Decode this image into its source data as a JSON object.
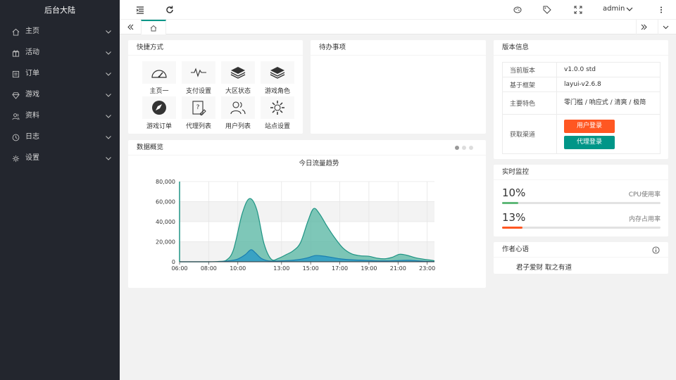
{
  "app": {
    "title": "后台大陆"
  },
  "sidebar": {
    "items": [
      {
        "label": "主页",
        "icon": "home-icon"
      },
      {
        "label": "活动",
        "icon": "gift-icon"
      },
      {
        "label": "订单",
        "icon": "order-icon"
      },
      {
        "label": "游戏",
        "icon": "diamond-icon"
      },
      {
        "label": "资料",
        "icon": "users-icon"
      },
      {
        "label": "日志",
        "icon": "clock-icon"
      },
      {
        "label": "设置",
        "icon": "gear-icon"
      }
    ]
  },
  "header": {
    "user": "admin",
    "icons": [
      "menu-fold-icon",
      "refresh-icon",
      "theme-icon",
      "tag-icon",
      "fullscreen-icon",
      "more-icon"
    ]
  },
  "tabs": {
    "home_icon": "home-icon"
  },
  "shortcuts": {
    "title": "快捷方式",
    "items": [
      {
        "label": "主页一",
        "icon": "dashboard-icon"
      },
      {
        "label": "支付设置",
        "icon": "pulse-icon"
      },
      {
        "label": "大区状态",
        "icon": "layers-icon"
      },
      {
        "label": "游戏角色",
        "icon": "layers-icon"
      },
      {
        "label": "游戏订单",
        "icon": "compass-icon"
      },
      {
        "label": "代理列表",
        "icon": "help-doc-icon"
      },
      {
        "label": "用户列表",
        "icon": "users-icon"
      },
      {
        "label": "站点设置",
        "icon": "gear-icon"
      }
    ]
  },
  "todo": {
    "title": "待办事项"
  },
  "version": {
    "title": "版本信息",
    "rows": [
      {
        "key": "当前版本",
        "value": "v1.0.0 std"
      },
      {
        "key": "基于框架",
        "value": "layui-v2.6.8"
      },
      {
        "key": "主要特色",
        "value": "零门槛 / 响应式 / 清爽 / 极简"
      },
      {
        "key": "获取渠道"
      }
    ],
    "buttons": [
      {
        "label": "用户登录",
        "color": "#ff5722"
      },
      {
        "label": "代理登录",
        "color": "#009688"
      }
    ]
  },
  "monitor": {
    "title": "实时监控",
    "items": [
      {
        "value": "10%",
        "label": "CPU使用率",
        "percent": 10,
        "color": "#5fb878"
      },
      {
        "value": "13%",
        "label": "内存占用率",
        "percent": 13,
        "color": "#ff5722"
      }
    ]
  },
  "author": {
    "title": "作者心语",
    "quote": "君子爱财 取之有道"
  },
  "overview": {
    "title": "数据概览"
  },
  "chart_data": {
    "type": "area",
    "title": "今日流量趋势",
    "x_ticks": [
      "06:00",
      "08:00",
      "10:00",
      "13:00",
      "15:00",
      "17:00",
      "19:00",
      "21:00",
      "23:00"
    ],
    "y_ticks": [
      "0",
      "20,000",
      "40,000",
      "60,000",
      "80,000"
    ],
    "ylim": [
      0,
      80000
    ],
    "xlim": [
      6,
      23.5
    ],
    "series": [
      {
        "color": "#5eb9a6",
        "x": [
          6,
          7,
          8,
          8.7,
          9.2,
          9.7,
          10.3,
          10.8,
          11.3,
          11.8,
          12.3,
          12.8,
          13.3,
          13.8,
          14.3,
          14.8,
          15.2,
          15.6,
          16.1,
          16.6,
          17.2,
          17.8,
          18.4,
          19.0,
          19.6,
          20.1,
          20.6,
          21.1,
          21.6,
          22.2,
          22.8,
          23.3,
          23.5
        ],
        "y": [
          0,
          0,
          0,
          400,
          1500,
          12000,
          48000,
          63000,
          52000,
          18000,
          2500,
          3500,
          7000,
          11000,
          19000,
          40000,
          53000,
          48000,
          36000,
          25000,
          14000,
          8000,
          6000,
          5500,
          3500,
          3000,
          4500,
          7500,
          6500,
          4000,
          2500,
          1500,
          1000
        ]
      },
      {
        "color": "#2e9bc6",
        "x": [
          6,
          8,
          9,
          9.5,
          10,
          10.5,
          10.9,
          11.2,
          11.6,
          12.1,
          12.6,
          13.2,
          13.8,
          14.3,
          14.8,
          15.3,
          15.8,
          16.4,
          17.0,
          17.8,
          18.6,
          19.4,
          20.2,
          21.0,
          21.7,
          22.4,
          23.0,
          23.5
        ],
        "y": [
          0,
          0,
          300,
          1200,
          2800,
          7000,
          12000,
          9000,
          3500,
          900,
          700,
          1000,
          1600,
          2500,
          4000,
          6200,
          5800,
          4500,
          3000,
          2000,
          1500,
          1000,
          900,
          1200,
          1500,
          900,
          400,
          200
        ]
      }
    ]
  }
}
